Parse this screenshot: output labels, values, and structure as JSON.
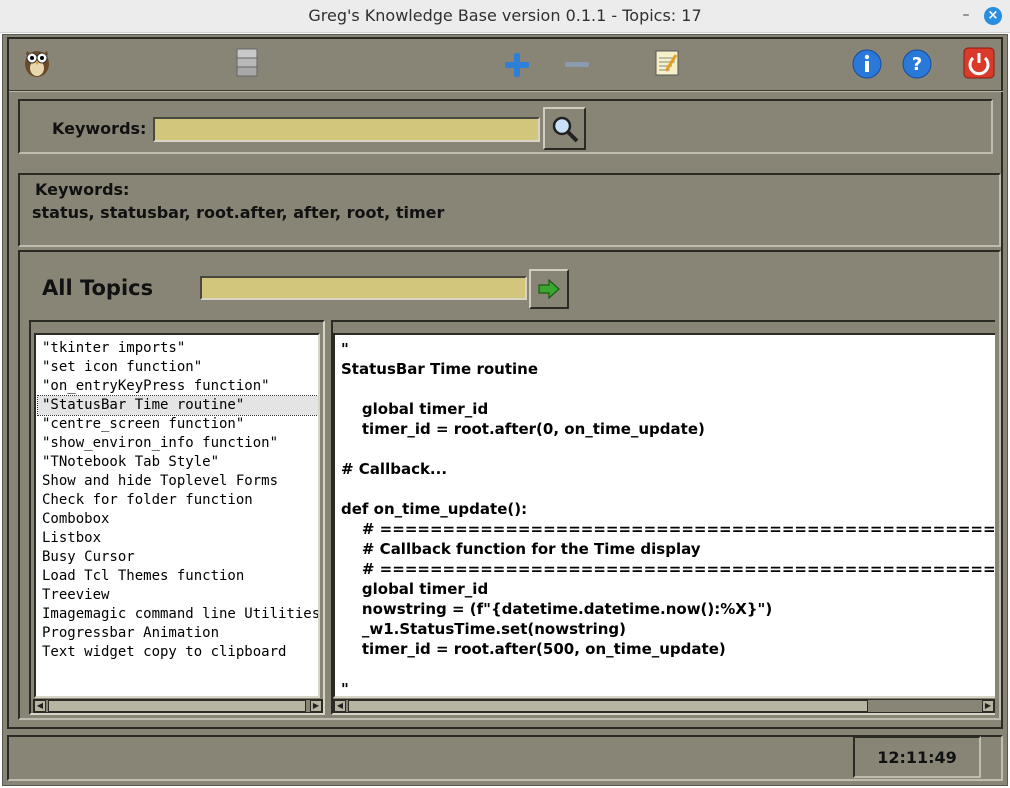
{
  "window": {
    "title": "Greg's Knowledge Base version 0.1.1 - Topics: 17",
    "minimize_glyph": "–",
    "close_glyph": "×"
  },
  "toolbar": {
    "icons": [
      "owl-logo-icon",
      "database-icon",
      "add-icon",
      "remove-icon",
      "edit-notepad-icon",
      "info-icon",
      "help-icon",
      "power-icon"
    ]
  },
  "search": {
    "label": "Keywords:",
    "value": "",
    "button_icon": "magnifier-icon"
  },
  "keywords_panel": {
    "label": "Keywords:",
    "value": "status, statusbar, root.after, after, root, timer"
  },
  "topics": {
    "title": "All Topics",
    "filter_value": "",
    "go_icon": "arrow-right-icon",
    "items": [
      "\"tkinter imports\"",
      "\"set icon function\"",
      "\"on_entryKeyPress function\"",
      "\"StatusBar Time routine\"",
      "\"centre_screen function\"",
      "\"show_environ_info function\"",
      "\"TNotebook Tab Style\"",
      "Show and hide Toplevel Forms",
      "Check for folder function",
      "Combobox",
      "Listbox",
      "Busy Cursor",
      "Load Tcl Themes function",
      "Treeview",
      "Imagemagic command line Utilities",
      "Progressbar Animation",
      "Text widget copy to clipboard"
    ],
    "selected_index": 3
  },
  "content": {
    "lines": [
      "\"",
      "StatusBar Time routine",
      "",
      "    global timer_id",
      "    timer_id = root.after(0, on_time_update)",
      "",
      "# Callback...",
      "",
      "def on_time_update():",
      "    # ===================================================================",
      "    # Callback function for the Time display",
      "    # ===================================================================",
      "    global timer_id",
      "    nowstring = (f\"{datetime.datetime.now():%X}\")",
      "    _w1.StatusTime.set(nowstring)",
      "    timer_id = root.after(500, on_time_update)",
      "",
      "\""
    ]
  },
  "status": {
    "time": "12:11:49"
  },
  "colors": {
    "panel": "#888576",
    "entry": "#d2c57c",
    "accent_blue": "#2a8ee0",
    "power_red": "#d93a2a"
  }
}
